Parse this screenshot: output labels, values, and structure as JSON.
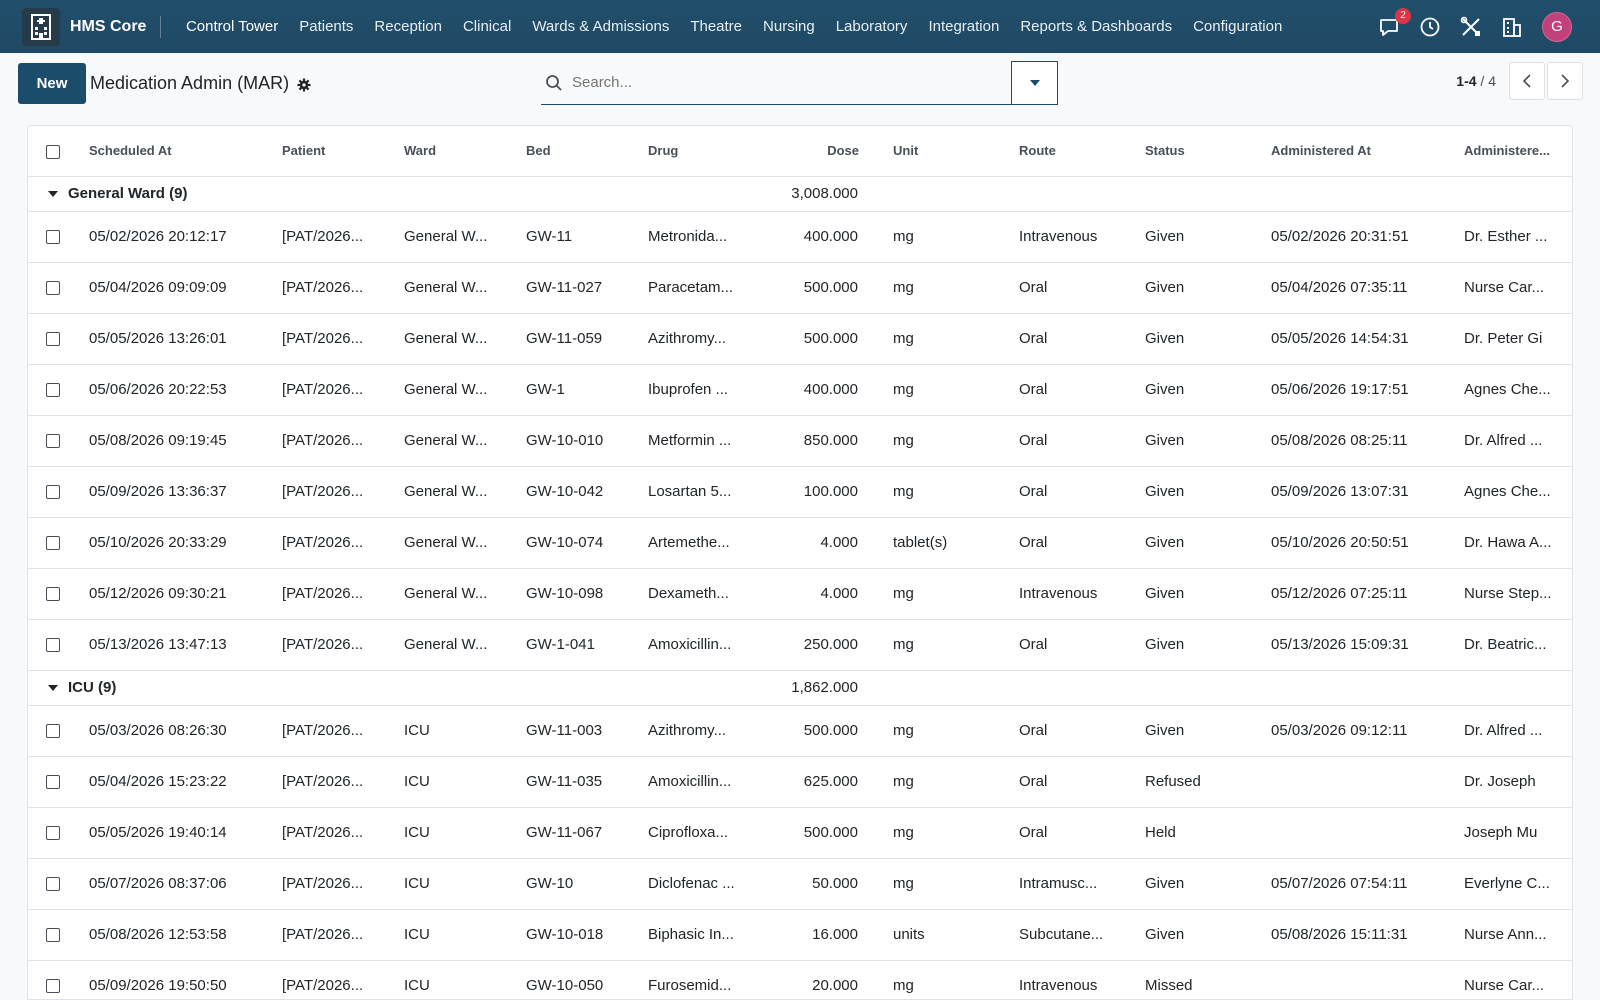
{
  "navbar": {
    "brand": "HMS Core",
    "menu": [
      "Control Tower",
      "Patients",
      "Reception",
      "Clinical",
      "Wards & Admissions",
      "Theatre",
      "Nursing",
      "Laboratory",
      "Integration",
      "Reports & Dashboards",
      "Configuration"
    ],
    "messages_badge": "2",
    "avatar_letter": "G"
  },
  "control": {
    "new_label": "New",
    "title": "Medication Admin (MAR)",
    "search_placeholder": "Search...",
    "pager_range": "1-4",
    "pager_total": " / 4"
  },
  "table": {
    "columns": [
      "Scheduled At",
      "Patient",
      "Ward",
      "Bed",
      "Drug",
      "Dose",
      "Unit",
      "Route",
      "Status",
      "Administered At",
      "Administere..."
    ],
    "groups": [
      {
        "name": "General Ward (9)",
        "total": "3,008.000",
        "rows": [
          [
            "05/02/2026 20:12:17",
            "[PAT/2026...",
            "General W...",
            "GW-11",
            "Metronida...",
            "400.000",
            "mg",
            "Intravenous",
            "Given",
            "05/02/2026 20:31:51",
            "Dr. Esther ..."
          ],
          [
            "05/04/2026 09:09:09",
            "[PAT/2026...",
            "General W...",
            "GW-11-027",
            "Paracetam...",
            "500.000",
            "mg",
            "Oral",
            "Given",
            "05/04/2026 07:35:11",
            "Nurse Car..."
          ],
          [
            "05/05/2026 13:26:01",
            "[PAT/2026...",
            "General W...",
            "GW-11-059",
            "Azithromy...",
            "500.000",
            "mg",
            "Oral",
            "Given",
            "05/05/2026 14:54:31",
            "Dr. Peter Gi"
          ],
          [
            "05/06/2026 20:22:53",
            "[PAT/2026...",
            "General W...",
            "GW-1",
            "Ibuprofen ...",
            "400.000",
            "mg",
            "Oral",
            "Given",
            "05/06/2026 19:17:51",
            "Agnes Che..."
          ],
          [
            "05/08/2026 09:19:45",
            "[PAT/2026...",
            "General W...",
            "GW-10-010",
            "Metformin ...",
            "850.000",
            "mg",
            "Oral",
            "Given",
            "05/08/2026 08:25:11",
            "Dr. Alfred ..."
          ],
          [
            "05/09/2026 13:36:37",
            "[PAT/2026...",
            "General W...",
            "GW-10-042",
            "Losartan 5...",
            "100.000",
            "mg",
            "Oral",
            "Given",
            "05/09/2026 13:07:31",
            "Agnes Che..."
          ],
          [
            "05/10/2026 20:33:29",
            "[PAT/2026...",
            "General W...",
            "GW-10-074",
            "Artemethe...",
            "4.000",
            "tablet(s)",
            "Oral",
            "Given",
            "05/10/2026 20:50:51",
            "Dr. Hawa A..."
          ],
          [
            "05/12/2026 09:30:21",
            "[PAT/2026...",
            "General W...",
            "GW-10-098",
            "Dexameth...",
            "4.000",
            "mg",
            "Intravenous",
            "Given",
            "05/12/2026 07:25:11",
            "Nurse Step..."
          ],
          [
            "05/13/2026 13:47:13",
            "[PAT/2026...",
            "General W...",
            "GW-1-041",
            "Amoxicillin...",
            "250.000",
            "mg",
            "Oral",
            "Given",
            "05/13/2026 15:09:31",
            "Dr. Beatric..."
          ]
        ]
      },
      {
        "name": "ICU (9)",
        "total": "1,862.000",
        "rows": [
          [
            "05/03/2026 08:26:30",
            "[PAT/2026...",
            "ICU",
            "GW-11-003",
            "Azithromy...",
            "500.000",
            "mg",
            "Oral",
            "Given",
            "05/03/2026 09:12:11",
            "Dr. Alfred ..."
          ],
          [
            "05/04/2026 15:23:22",
            "[PAT/2026...",
            "ICU",
            "GW-11-035",
            "Amoxicillin...",
            "625.000",
            "mg",
            "Oral",
            "Refused",
            "",
            "Dr. Joseph"
          ],
          [
            "05/05/2026 19:40:14",
            "[PAT/2026...",
            "ICU",
            "GW-11-067",
            "Ciprofloxa...",
            "500.000",
            "mg",
            "Oral",
            "Held",
            "",
            "Joseph Mu"
          ],
          [
            "05/07/2026 08:37:06",
            "[PAT/2026...",
            "ICU",
            "GW-10",
            "Diclofenac ...",
            "50.000",
            "mg",
            "Intramusc...",
            "Given",
            "05/07/2026 07:54:11",
            "Everlyne C..."
          ],
          [
            "05/08/2026 12:53:58",
            "[PAT/2026...",
            "ICU",
            "GW-10-018",
            "Biphasic In...",
            "16.000",
            "units",
            "Subcutane...",
            "Given",
            "05/08/2026 15:11:31",
            "Nurse Ann..."
          ],
          [
            "05/09/2026 19:50:50",
            "[PAT/2026...",
            "ICU",
            "GW-10-050",
            "Furosemid...",
            "20.000",
            "mg",
            "Intravenous",
            "Missed",
            "",
            "Nurse Car..."
          ]
        ]
      }
    ]
  },
  "colors": {
    "navbar": "#1f4a66",
    "primary": "#1c4c6b",
    "badge": "#dc3545",
    "avatar": "#c2417a"
  },
  "icons": [
    "hospital-building-icon",
    "chat-icon",
    "clock-icon",
    "tools-icon",
    "building-icon",
    "gear-icon",
    "search-icon",
    "caret-down-icon",
    "chevron-left-icon",
    "chevron-right-icon"
  ]
}
